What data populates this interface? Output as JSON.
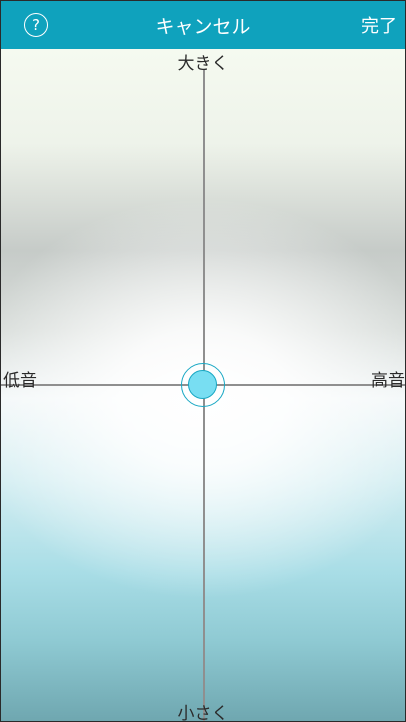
{
  "header": {
    "help_label": "?",
    "cancel_label": "キャンセル",
    "done_label": "完了"
  },
  "pad": {
    "top_label": "大きく",
    "bottom_label": "小さく",
    "left_label": "低音",
    "right_label": "高音",
    "handle_position": {
      "x": 0.0,
      "y": 0.0
    }
  },
  "colors": {
    "header_bg": "#0fa2bd",
    "handle_fill": "#78def2",
    "handle_stroke": "#19a8c4"
  }
}
